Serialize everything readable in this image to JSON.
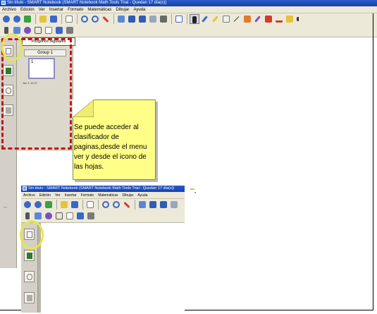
{
  "window": {
    "title": "Sin título - SMART Notebook (SMART Notebook Math Tools Trial - Quedan 17 día(s))"
  },
  "menu": [
    "Archivo",
    "Edición",
    "Ver",
    "Insertar",
    "Formato",
    "Matemáticas",
    "Dibujar",
    "Ayuda"
  ],
  "toolbar_row1_icons": [
    "back-icon",
    "forward-icon",
    "add-page-icon",
    "open-icon",
    "save-icon",
    "paste-icon",
    "undo-icon",
    "redo-icon",
    "delete-icon",
    "screen-shade-icon",
    "full-screen-icon",
    "dual-screen-icon",
    "capture-icon",
    "document-camera-icon",
    "table-icon",
    "select-icon",
    "pen-icon",
    "creative-pen-icon",
    "eraser-icon",
    "line-icon",
    "shape-icon",
    "magic-pen-icon",
    "fill-icon",
    "text-icon",
    "properties-icon",
    "more-icon"
  ],
  "toolbar_row2_icons": [
    "sigma-icon",
    "measure-icon",
    "shapes-icon",
    "text-tool-icon",
    "page-icon",
    "edit-icon",
    "gallery-icon"
  ],
  "icon_colors": {
    "blue": "#3b67c7",
    "green": "#3aa041",
    "red": "#d23b2d",
    "yellow": "#e7c33a",
    "purple": "#7b4fbf",
    "gray": "#7a7a7a"
  },
  "sorter": {
    "tooltip": "Polígonos regulares",
    "group_label": "Group 1",
    "page_number": "1",
    "page_date": "Jan 1-11:37"
  },
  "side_tabs": [
    "page-sorter-icon",
    "gallery-icon",
    "attachments-icon",
    "properties-icon"
  ],
  "drag_hint": "↔",
  "note": {
    "text": "Se puede acceder al clasificador de paginas,desde el menu ver y desde el icono de las hojas."
  },
  "second_window": {
    "title": "Sin título - SMART Notebook (SMART Notebook Math Tools Trial - Quedan 17 día(s))",
    "menu": [
      "Archivo",
      "Edición",
      "Ver",
      "Insertar",
      "Formato",
      "Matemáticas",
      "Dibujar",
      "Ayuda"
    ]
  },
  "annotation_colors": {
    "dashed_box": "#c0161c",
    "circle": "#e8e64a",
    "note_bg": "#ffff88"
  }
}
